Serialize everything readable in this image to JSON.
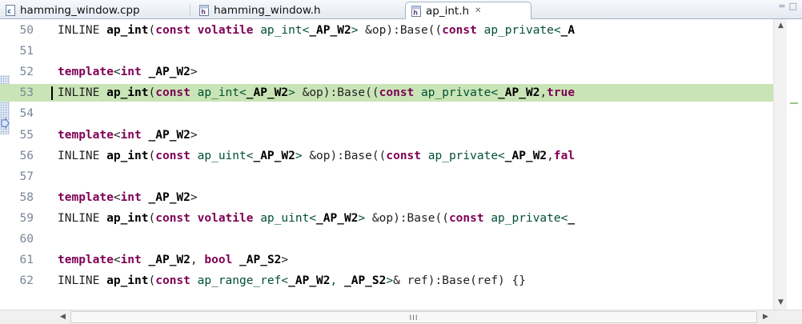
{
  "tabs": [
    {
      "label": "hamming_window.cpp",
      "icon": "cpp-file-icon",
      "active": false
    },
    {
      "label": "hamming_window.h",
      "icon": "header-file-icon",
      "active": false
    },
    {
      "label": "ap_int.h",
      "icon": "header-file-icon",
      "active": true,
      "close": "✕"
    }
  ],
  "view_buttons": {
    "minimize": "=",
    "maximize": "□"
  },
  "editor": {
    "current_line": "53",
    "lines": [
      {
        "num": "50",
        "parts": [
          [
            "",
            "INLINE "
          ],
          [
            "b",
            "ap_int"
          ],
          [
            "",
            "("
          ],
          [
            "kw",
            "const"
          ],
          [
            "",
            " "
          ],
          [
            "kw",
            "volatile"
          ],
          [
            "",
            " "
          ],
          [
            "ty",
            "ap_int<"
          ],
          [
            "b",
            "_AP_W2"
          ],
          [
            "ty",
            ">"
          ],
          [
            "",
            " &op):Base(("
          ],
          [
            "kw",
            "const"
          ],
          [
            "",
            " "
          ],
          [
            "ty",
            "ap_private<"
          ],
          [
            "b",
            "_A"
          ]
        ]
      },
      {
        "num": "51",
        "parts": []
      },
      {
        "num": "52",
        "parts": [
          [
            "kw",
            "template"
          ],
          [
            "",
            "<"
          ],
          [
            "kw",
            "int"
          ],
          [
            "",
            " "
          ],
          [
            "b",
            "_AP_W2"
          ],
          [
            "",
            ">"
          ]
        ]
      },
      {
        "num": "53",
        "parts": [
          [
            "",
            "INLINE "
          ],
          [
            "b",
            "ap_int"
          ],
          [
            "",
            "("
          ],
          [
            "kw",
            "const"
          ],
          [
            "",
            " "
          ],
          [
            "ty",
            "ap_int<"
          ],
          [
            "b",
            "_AP_W2"
          ],
          [
            "ty",
            ">"
          ],
          [
            "",
            " &op):Base(("
          ],
          [
            "kw",
            "const"
          ],
          [
            "",
            " "
          ],
          [
            "ty",
            "ap_private<"
          ],
          [
            "b",
            "_AP_W2"
          ],
          [
            "",
            ","
          ],
          [
            "kw",
            "true"
          ]
        ]
      },
      {
        "num": "54",
        "parts": []
      },
      {
        "num": "55",
        "parts": [
          [
            "kw",
            "template"
          ],
          [
            "",
            "<"
          ],
          [
            "kw",
            "int"
          ],
          [
            "",
            " "
          ],
          [
            "b",
            "_AP_W2"
          ],
          [
            "",
            ">"
          ]
        ]
      },
      {
        "num": "56",
        "parts": [
          [
            "",
            "INLINE "
          ],
          [
            "b",
            "ap_int"
          ],
          [
            "",
            "("
          ],
          [
            "kw",
            "const"
          ],
          [
            "",
            " "
          ],
          [
            "ty",
            "ap_uint<"
          ],
          [
            "b",
            "_AP_W2"
          ],
          [
            "ty",
            ">"
          ],
          [
            "",
            " &op):Base(("
          ],
          [
            "kw",
            "const"
          ],
          [
            "",
            " "
          ],
          [
            "ty",
            "ap_private<"
          ],
          [
            "b",
            "_AP_W2"
          ],
          [
            "",
            ","
          ],
          [
            "kw",
            "fal"
          ]
        ]
      },
      {
        "num": "57",
        "parts": []
      },
      {
        "num": "58",
        "parts": [
          [
            "kw",
            "template"
          ],
          [
            "",
            "<"
          ],
          [
            "kw",
            "int"
          ],
          [
            "",
            " "
          ],
          [
            "b",
            "_AP_W2"
          ],
          [
            "",
            ">"
          ]
        ]
      },
      {
        "num": "59",
        "parts": [
          [
            "",
            "INLINE "
          ],
          [
            "b",
            "ap_int"
          ],
          [
            "",
            "("
          ],
          [
            "kw",
            "const"
          ],
          [
            "",
            " "
          ],
          [
            "kw",
            "volatile"
          ],
          [
            "",
            " "
          ],
          [
            "ty",
            "ap_uint<"
          ],
          [
            "b",
            "_AP_W2"
          ],
          [
            "ty",
            ">"
          ],
          [
            "",
            " &op):Base(("
          ],
          [
            "kw",
            "const"
          ],
          [
            "",
            " "
          ],
          [
            "ty",
            "ap_private<"
          ],
          [
            "b",
            "_"
          ]
        ]
      },
      {
        "num": "60",
        "parts": []
      },
      {
        "num": "61",
        "parts": [
          [
            "kw",
            "template"
          ],
          [
            "",
            "<"
          ],
          [
            "kw",
            "int"
          ],
          [
            "",
            " "
          ],
          [
            "b",
            "_AP_W2"
          ],
          [
            "",
            ", "
          ],
          [
            "kw",
            "bool"
          ],
          [
            "",
            " "
          ],
          [
            "b",
            "_AP_S2"
          ],
          [
            "",
            ">"
          ]
        ]
      },
      {
        "num": "62",
        "parts": [
          [
            "",
            "INLINE "
          ],
          [
            "b",
            "ap_int"
          ],
          [
            "",
            "("
          ],
          [
            "kw",
            "const"
          ],
          [
            "",
            " "
          ],
          [
            "ty",
            "ap_range_ref<"
          ],
          [
            "b",
            "_AP_W2"
          ],
          [
            "ty",
            ", "
          ],
          [
            "b",
            "_AP_S2"
          ],
          [
            "ty",
            ">"
          ],
          [
            "",
            "& ref):Base(ref) {}"
          ]
        ]
      }
    ]
  },
  "scroll": {
    "up": "▲",
    "down": "▼",
    "left": "◀",
    "right": "▶",
    "grip": "III"
  }
}
